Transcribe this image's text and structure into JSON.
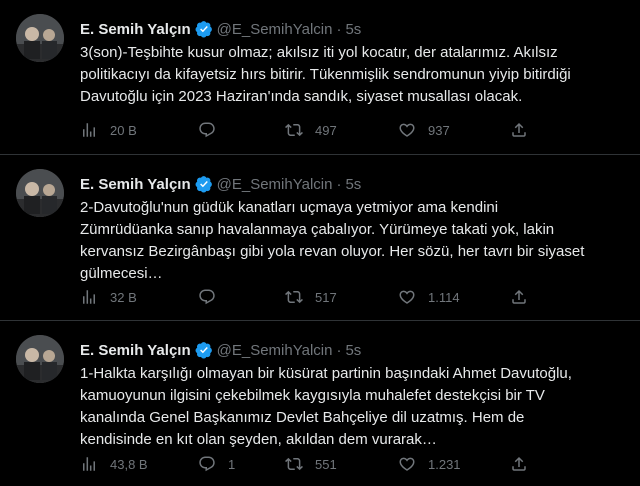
{
  "tweets": [
    {
      "author_name": "E. Semih Yalçın",
      "handle": "@E_SemihYalcin",
      "dot": "·",
      "time": "5s",
      "text": "3(son)-Teşbihte kusur olmaz; akılsız iti yol kocatır, der atalarımız. Akılsız\npolitikacıyı da kifayetsiz hırs bitirir. Tükenmişlik sendromunun yiyip bitirdiği\nDavutoğlu için 2023 Haziran'ında sandık, siyaset musallası olacak.",
      "views": "20 B",
      "replies": "",
      "retweets": "497",
      "likes": "937"
    },
    {
      "author_name": "E. Semih Yalçın",
      "handle": "@E_SemihYalcin",
      "dot": "·",
      "time": "5s",
      "text": "2-Davutoğlu'nun güdük kanatları uçmaya yetmiyor ama kendini\nZümrüdüanka sanıp havalanmaya çabalıyor. Yürümeye takati yok, lakin\nkervansız Bezirgânbaşı gibi yola revan oluyor. Her sözü, her tavrı bir siyaset\ngülmecesi…",
      "views": "32 B",
      "replies": "",
      "retweets": "517",
      "likes": "1.114"
    },
    {
      "author_name": "E. Semih Yalçın",
      "handle": "@E_SemihYalcin",
      "dot": "·",
      "time": "5s",
      "text": "1-Halkta karşılığı olmayan bir küsürat partinin başındaki Ahmet Davutoğlu,\nkamuoyunun ilgisini çekebilmek kaygısıyla muhalefet destekçisi bir TV\nkanalında Genel Başkanımız Devlet Bahçeliye dil uzatmış. Hem de\nkendisinde en kıt olan şeyden, akıldan dem vurarak…",
      "views": "43,8 B",
      "replies": "1",
      "retweets": "551",
      "likes": "1.231"
    }
  ],
  "colors": {
    "background": "#000000",
    "text": "#e7e9ea",
    "secondary": "#71767b",
    "divider": "#2f3336",
    "verified": "#1d9bf0"
  },
  "icons": [
    "verified-badge-icon",
    "views-icon",
    "reply-icon",
    "retweet-icon",
    "like-icon",
    "share-icon"
  ]
}
